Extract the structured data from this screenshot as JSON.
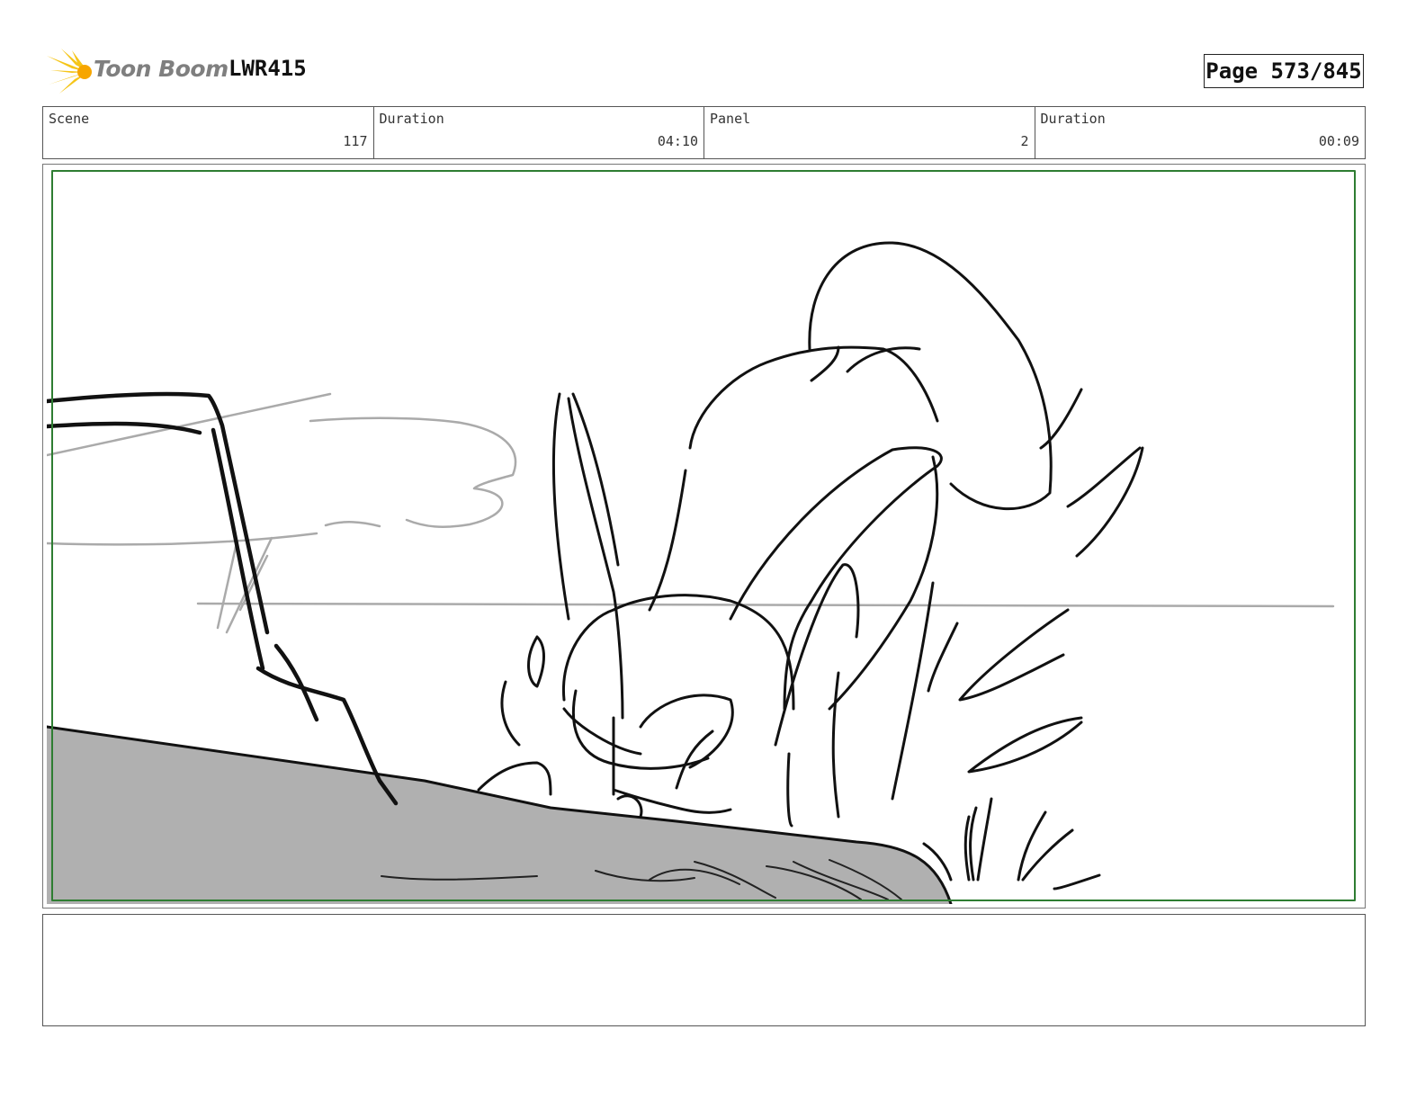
{
  "header": {
    "logo_text": "Toon Boom",
    "project": "LWR415",
    "page": "Page 573/845"
  },
  "info": [
    {
      "label": "Scene",
      "value": "117"
    },
    {
      "label": "Duration",
      "value": "04:10"
    },
    {
      "label": "Panel",
      "value": "2"
    },
    {
      "label": "Duration",
      "value": "00:09"
    }
  ],
  "notes": {
    "text": ""
  },
  "colors": {
    "safe_frame": "#2e7d32",
    "ground_fill": "#b0b0b0",
    "logo_yellow": "#f5c518"
  },
  "icons": {
    "logo": "toon-boom-burst-logo"
  }
}
